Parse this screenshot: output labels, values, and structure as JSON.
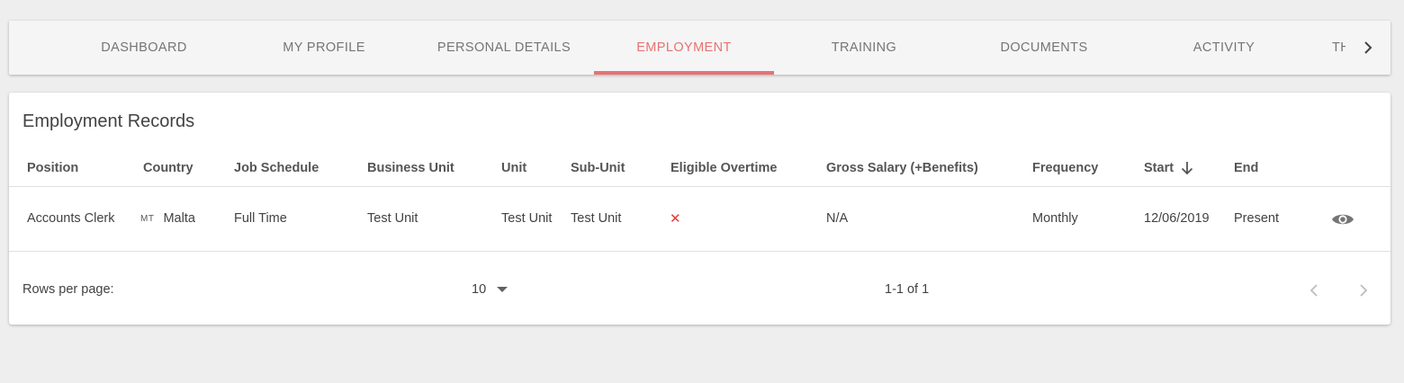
{
  "tabs": [
    {
      "label": "DASHBOARD",
      "active": false
    },
    {
      "label": "MY PROFILE",
      "active": false
    },
    {
      "label": "PERSONAL DETAILS",
      "active": false
    },
    {
      "label": "EMPLOYMENT",
      "active": true
    },
    {
      "label": "TRAINING",
      "active": false
    },
    {
      "label": "DOCUMENTS",
      "active": false
    },
    {
      "label": "ACTIVITY",
      "active": false
    },
    {
      "label": "TH",
      "active": false
    }
  ],
  "card": {
    "title": "Employment Records"
  },
  "table": {
    "headers": {
      "position": "Position",
      "country": "Country",
      "job_schedule": "Job Schedule",
      "business_unit": "Business Unit",
      "unit": "Unit",
      "sub_unit": "Sub-Unit",
      "eligible_overtime": "Eligible Overtime",
      "gross_salary": "Gross Salary (+Benefits)",
      "frequency": "Frequency",
      "start": "Start",
      "end": "End"
    },
    "rows": [
      {
        "position": "Accounts Clerk",
        "country_code": "MT",
        "country": "Malta",
        "job_schedule": "Full Time",
        "business_unit": "Test Unit",
        "unit": "Test Unit",
        "sub_unit": "Test Unit",
        "eligible_overtime": "✕",
        "gross_salary": "N/A",
        "frequency": "Monthly",
        "start": "12/06/2019",
        "end": "Present"
      }
    ]
  },
  "footer": {
    "rows_per_page_label": "Rows per page:",
    "rows_per_page_value": "10",
    "page_range": "1-1 of 1"
  },
  "colors": {
    "accent": "#e57373",
    "background": "#eeeeee",
    "card": "#ffffff"
  },
  "icons": {
    "tabs_next": "chevron-right-icon",
    "sort_start": "arrow-down-icon",
    "overtime_no": "close-icon",
    "view": "eye-icon",
    "rows_dropdown": "caret-down-icon",
    "prev_page": "chevron-left-icon",
    "next_page": "chevron-right-icon"
  }
}
